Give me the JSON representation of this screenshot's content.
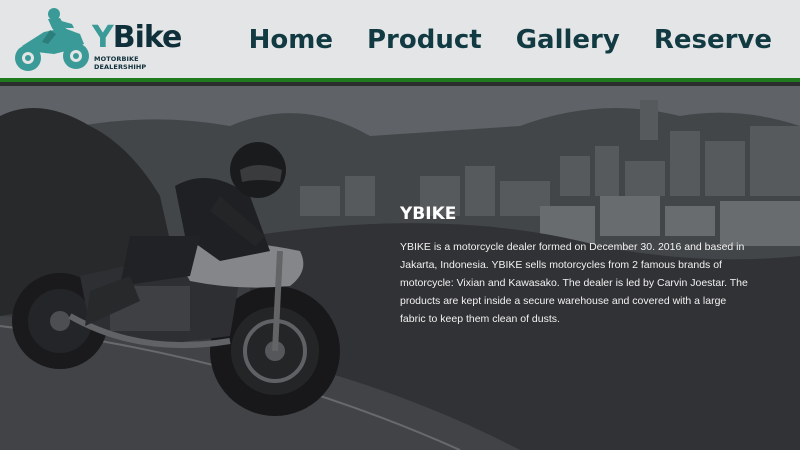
{
  "header": {
    "brand": {
      "initial": "Y",
      "name": "Bike",
      "tagline": "MOTORBIKE DEALERSHIHP"
    },
    "nav": [
      "Home",
      "Product",
      "Gallery",
      "Reserve"
    ]
  },
  "hero": {
    "title": "YBIKE",
    "description": "YBIKE is a motorcycle dealer formed on December 30. 2016 and based in Jakarta, Indonesia. YBIKE sells motorcycles from 2 famous brands of motorcycle: Vixian and Kawasako. The dealer is led by Carvin Joestar. The products are kept inside a secure warehouse and covered with a large fabric to keep them clean of dusts."
  },
  "colors": {
    "accent_teal": "#3a9a97",
    "nav_text": "#123a42",
    "header_border": "#1f7a1f",
    "header_bg": "#e4e5e6"
  },
  "icons": [
    "motorbike-rider-logo-icon"
  ]
}
